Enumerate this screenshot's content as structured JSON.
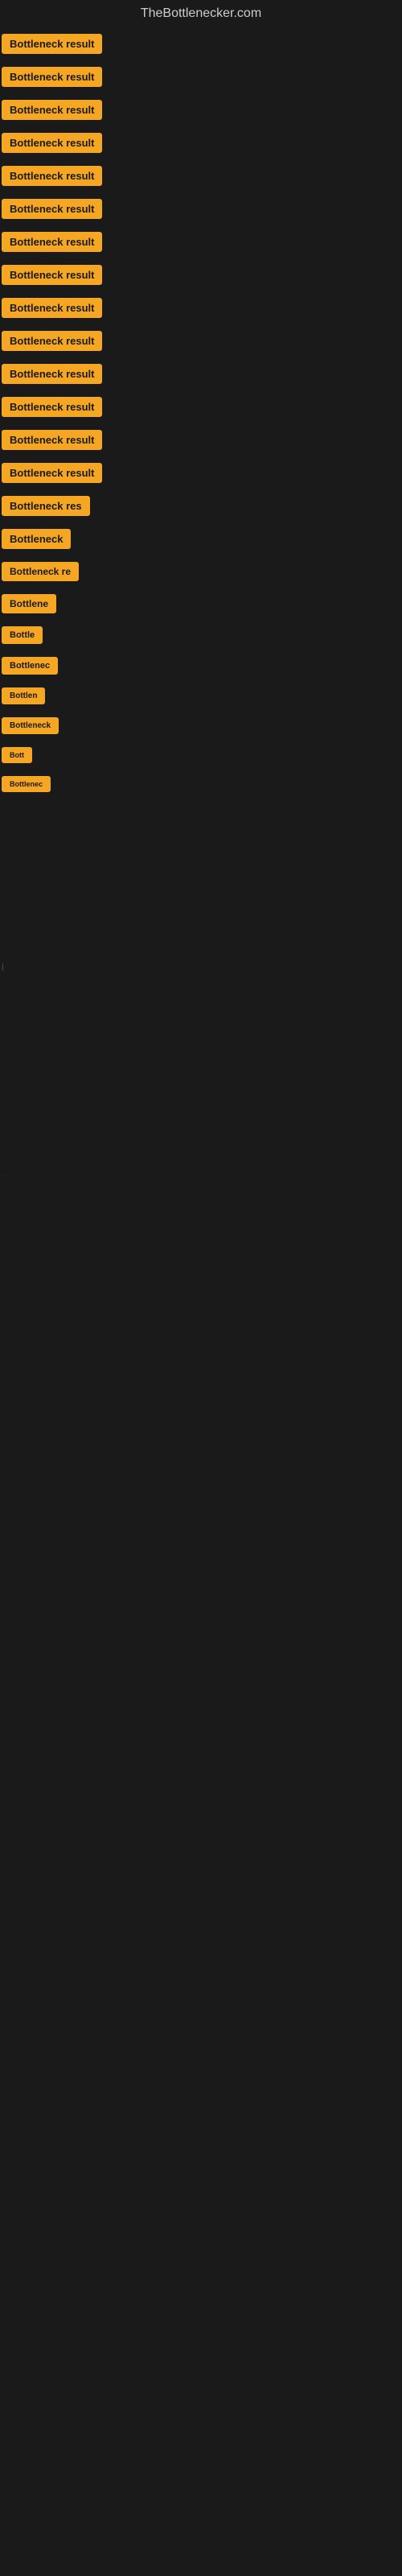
{
  "site": {
    "title": "TheBottlenecker.com"
  },
  "rows": [
    {
      "id": 1,
      "label": "Bottleneck result"
    },
    {
      "id": 2,
      "label": "Bottleneck result"
    },
    {
      "id": 3,
      "label": "Bottleneck result"
    },
    {
      "id": 4,
      "label": "Bottleneck result"
    },
    {
      "id": 5,
      "label": "Bottleneck result"
    },
    {
      "id": 6,
      "label": "Bottleneck result"
    },
    {
      "id": 7,
      "label": "Bottleneck result"
    },
    {
      "id": 8,
      "label": "Bottleneck result"
    },
    {
      "id": 9,
      "label": "Bottleneck result"
    },
    {
      "id": 10,
      "label": "Bottleneck result"
    },
    {
      "id": 11,
      "label": "Bottleneck result"
    },
    {
      "id": 12,
      "label": "Bottleneck result"
    },
    {
      "id": 13,
      "label": "Bottleneck result"
    },
    {
      "id": 14,
      "label": "Bottleneck result"
    },
    {
      "id": 15,
      "label": "Bottleneck res"
    },
    {
      "id": 16,
      "label": "Bottleneck"
    },
    {
      "id": 17,
      "label": "Bottleneck re"
    },
    {
      "id": 18,
      "label": "Bottlene"
    },
    {
      "id": 19,
      "label": "Bottle"
    },
    {
      "id": 20,
      "label": "Bottlenec"
    },
    {
      "id": 21,
      "label": "Bottlen"
    },
    {
      "id": 22,
      "label": "Bottleneck"
    },
    {
      "id": 23,
      "label": "Bott"
    },
    {
      "id": 24,
      "label": "Bottlenec"
    }
  ],
  "colors": {
    "badge_bg": "#f5a623",
    "badge_text": "#1a1a1a",
    "page_bg": "#1a1a1a",
    "title_text": "#cccccc"
  }
}
